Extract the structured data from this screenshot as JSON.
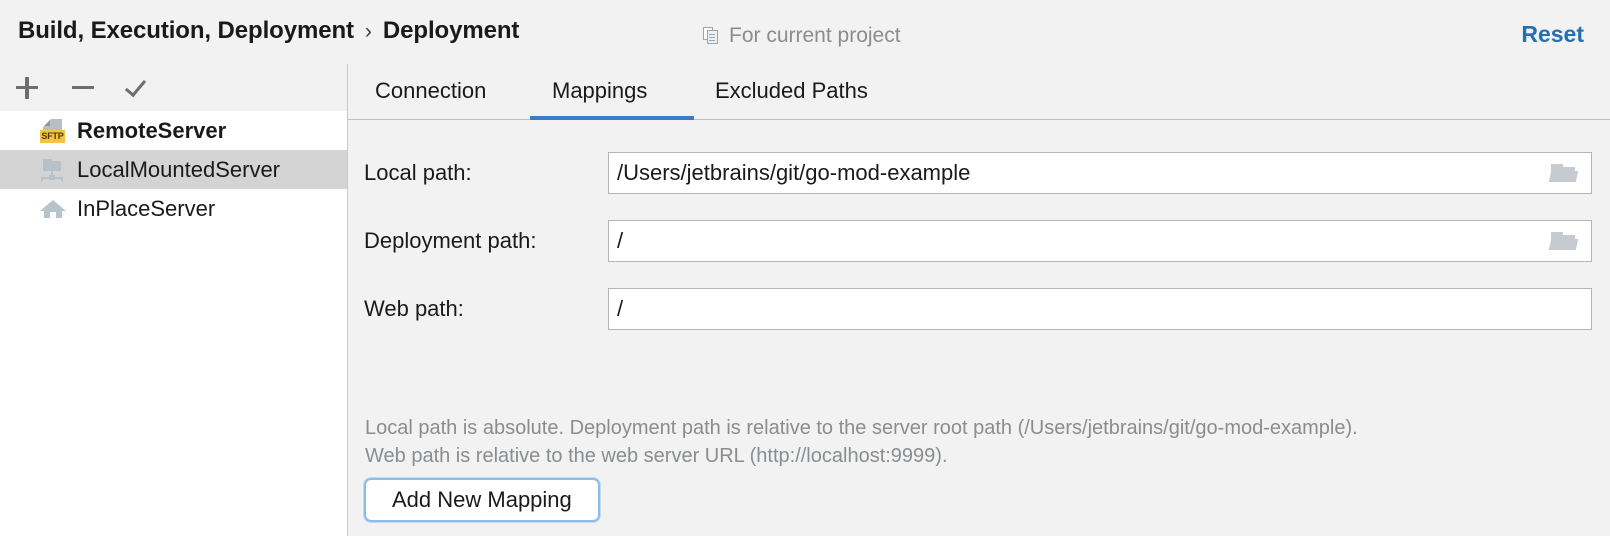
{
  "header": {
    "breadcrumb": {
      "root": "Build, Execution, Deployment",
      "separator": "›",
      "leaf": "Deployment"
    },
    "scope_icon": "copy-icon",
    "scope_label": "For current project",
    "reset_label": "Reset",
    "reset_color": "#2470b3"
  },
  "sidebar": {
    "toolbar": [
      {
        "name": "add-server-button",
        "icon": "plus-icon"
      },
      {
        "name": "remove-server-button",
        "icon": "minus-icon"
      },
      {
        "name": "set-default-server-button",
        "icon": "check-icon"
      }
    ],
    "servers": [
      {
        "label": "RemoteServer",
        "icon": "sftp-server-icon",
        "selected": false,
        "bold": true
      },
      {
        "label": "LocalMountedServer",
        "icon": "mounted-folder-icon",
        "selected": true,
        "bold": false
      },
      {
        "label": "InPlaceServer",
        "icon": "house-icon",
        "selected": false,
        "bold": false
      }
    ],
    "selected_background": "#d4d4d4"
  },
  "tabs": [
    {
      "label": "Connection",
      "active": false
    },
    {
      "label": "Mappings",
      "active": true
    },
    {
      "label": "Excluded Paths",
      "active": false
    }
  ],
  "tab_accent_color": "#3c7cc4",
  "mappings": {
    "fields": [
      {
        "label": "Local path:",
        "value": "/Users/jetbrains/git/go-mod-example",
        "placeholder": "",
        "has_browse_button": true,
        "browse_icon": "folder-icon"
      },
      {
        "label": "Deployment path:",
        "value": "/",
        "placeholder": "",
        "has_browse_button": true,
        "browse_icon": "folder-icon"
      },
      {
        "label": "Web path:",
        "value": "/",
        "placeholder": "",
        "has_browse_button": false,
        "browse_icon": ""
      }
    ],
    "hint_line_1": "Local path is absolute. Deployment path is relative to the server root path (/Users/jetbrains/git/go-mod-example).",
    "hint_line_2": "Web path is relative to the web server URL (http://localhost:9999).",
    "add_button_label": "Add New Mapping"
  }
}
